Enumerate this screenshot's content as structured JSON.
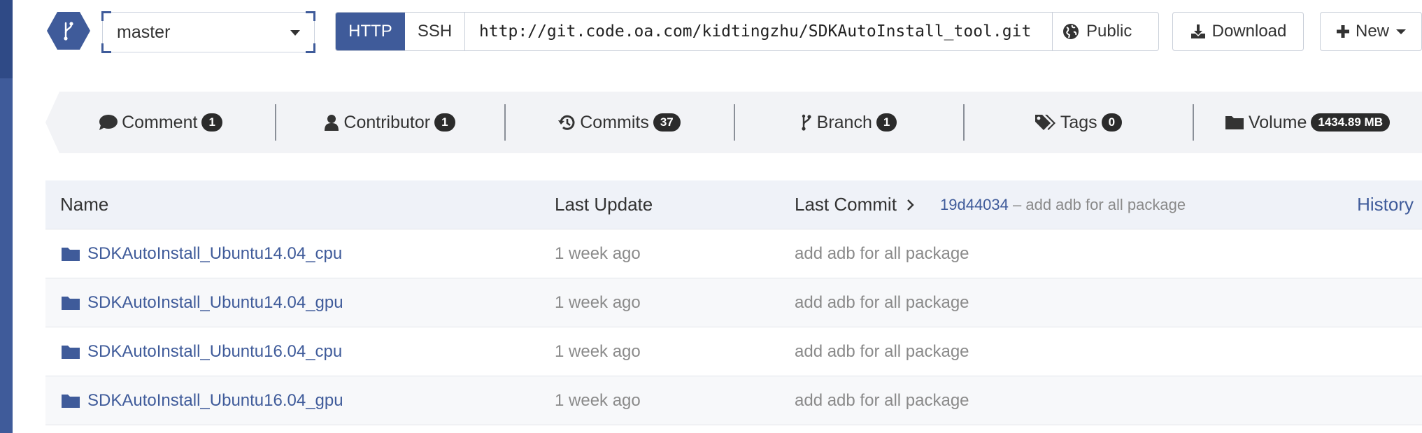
{
  "branch": {
    "selected": "master"
  },
  "clone": {
    "http_label": "HTTP",
    "ssh_label": "SSH",
    "url": "http://git.code.oa.com/kidtingzhu/SDKAutoInstall_tool.git",
    "visibility": "Public"
  },
  "actions": {
    "download_label": "Download",
    "new_label": "New"
  },
  "stats": {
    "comment": {
      "label": "Comment",
      "count": "1"
    },
    "contributor": {
      "label": "Contributor",
      "count": "1"
    },
    "commits": {
      "label": "Commits",
      "count": "37"
    },
    "branch": {
      "label": "Branch",
      "count": "1"
    },
    "tags": {
      "label": "Tags",
      "count": "0"
    },
    "volume": {
      "label": "Volume",
      "count": "1434.89 MB"
    }
  },
  "table": {
    "headers": {
      "name": "Name",
      "last_update": "Last Update",
      "last_commit": "Last Commit",
      "history": "History"
    },
    "latest_commit": {
      "sha": "19d44034",
      "message": "– add adb for all package"
    },
    "rows": [
      {
        "name": "SDKAutoInstall_Ubuntu14.04_cpu",
        "updated": "1 week ago",
        "message": "add adb for all package"
      },
      {
        "name": "SDKAutoInstall_Ubuntu14.04_gpu",
        "updated": "1 week ago",
        "message": "add adb for all package"
      },
      {
        "name": "SDKAutoInstall_Ubuntu16.04_cpu",
        "updated": "1 week ago",
        "message": "add adb for all package"
      },
      {
        "name": "SDKAutoInstall_Ubuntu16.04_gpu",
        "updated": "1 week ago",
        "message": "add adb for all package"
      }
    ]
  },
  "colors": {
    "accent": "#3f5b9a",
    "badge": "#2b2b2b",
    "muted": "#8a8a8a"
  }
}
